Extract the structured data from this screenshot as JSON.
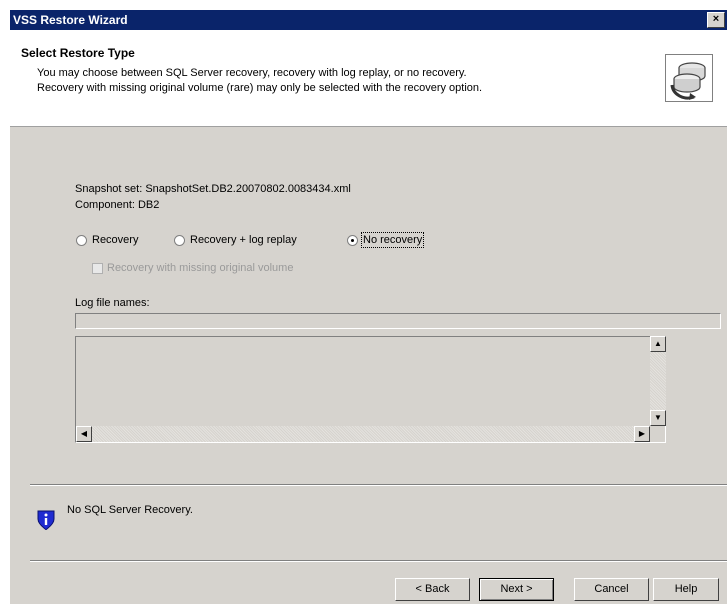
{
  "window": {
    "title": "VSS Restore Wizard",
    "close_glyph": "×"
  },
  "header": {
    "title": "Select Restore Type",
    "description_line1": "You may choose between SQL Server recovery, recovery with log replay, or no recovery.",
    "description_line2": "Recovery with missing original volume (rare) may only be selected with the recovery option.",
    "icon": "database-restore-icon"
  },
  "details": {
    "snapshot_set": "Snapshot set: SnapshotSet.DB2.20070802.0083434.xml",
    "component": "Component:  DB2"
  },
  "options": {
    "recovery": "Recovery",
    "recovery_log_replay": "Recovery + log replay",
    "no_recovery": "No recovery",
    "selected": "No recovery",
    "missing_volume": "Recovery with missing original volume",
    "missing_volume_checked": false
  },
  "log_files": {
    "label": "Log file names:",
    "value": ""
  },
  "status": {
    "icon": "info-shield-icon",
    "message": "No SQL Server Recovery."
  },
  "buttons": {
    "back": "< Back",
    "next": "Next >",
    "cancel": "Cancel",
    "help": "Help"
  },
  "colors": {
    "titlebar": "#0a246a",
    "face": "#d6d3ce",
    "header": "#ffffff",
    "info_icon": "#1f2bd1"
  }
}
